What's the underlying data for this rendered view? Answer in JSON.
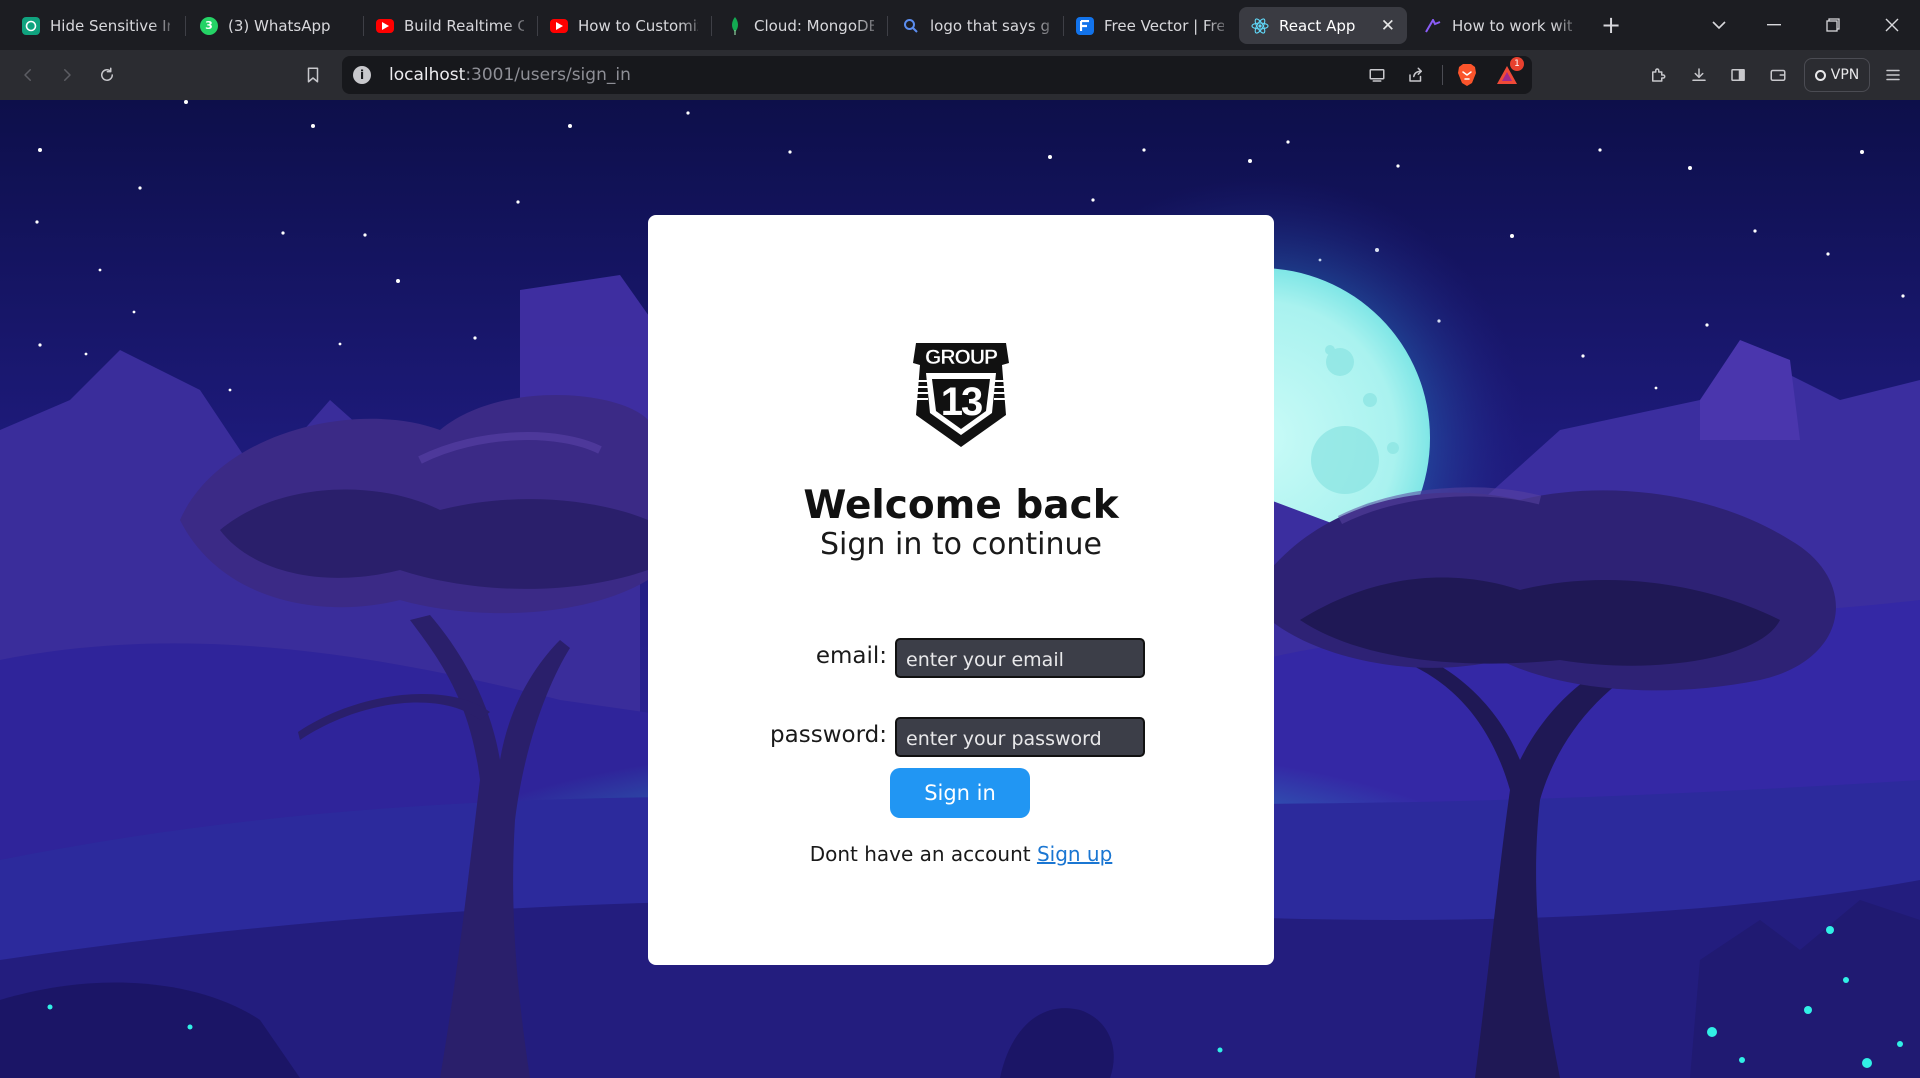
{
  "browser": {
    "tabs": [
      {
        "title": "Hide Sensitive Info",
        "icon": "openai-icon",
        "color": "#10a37f"
      },
      {
        "title": "(3) WhatsApp",
        "icon": "whatsapp-icon",
        "color": "#25d366",
        "badge": "3"
      },
      {
        "title": "Build Realtime Chat",
        "icon": "youtube-icon",
        "color": "#ff0000"
      },
      {
        "title": "How to Customize",
        "icon": "youtube-icon",
        "color": "#ff0000"
      },
      {
        "title": "Cloud: MongoDB",
        "icon": "mongodb-leaf-icon",
        "color": "#13aa52"
      },
      {
        "title": "logo that says group",
        "icon": "search-icon",
        "color": "#5b8def"
      },
      {
        "title": "Free Vector | Free",
        "icon": "freepik-icon",
        "color": "#1273eb"
      },
      {
        "title": "React App",
        "icon": "react-icon",
        "color": "#61dafb",
        "active": true
      },
      {
        "title": "How to work with",
        "icon": "cursor-icon",
        "color": "#8a5cf6"
      }
    ],
    "new_tab_label": "+",
    "address": {
      "host": "localhost",
      "path": ":3001/users/sign_in"
    },
    "brave_badge_count": "1",
    "vpn_label": "VPN"
  },
  "logo": {
    "top_text": "GROUP",
    "number": "13"
  },
  "signin": {
    "heading": "Welcome back",
    "subheading": "Sign in to continue",
    "email_label": "email:",
    "email_placeholder": "enter your email",
    "password_label": "password:",
    "password_placeholder": "enter your password",
    "button_label": "Sign in",
    "footer_text": "Dont have an account ",
    "signup_link": "Sign up"
  },
  "colors": {
    "sky": "#1a1870",
    "moon": "#b6f4f2",
    "button": "#2196f3",
    "link": "#1a76d2",
    "input_bg": "#3c3e48"
  }
}
